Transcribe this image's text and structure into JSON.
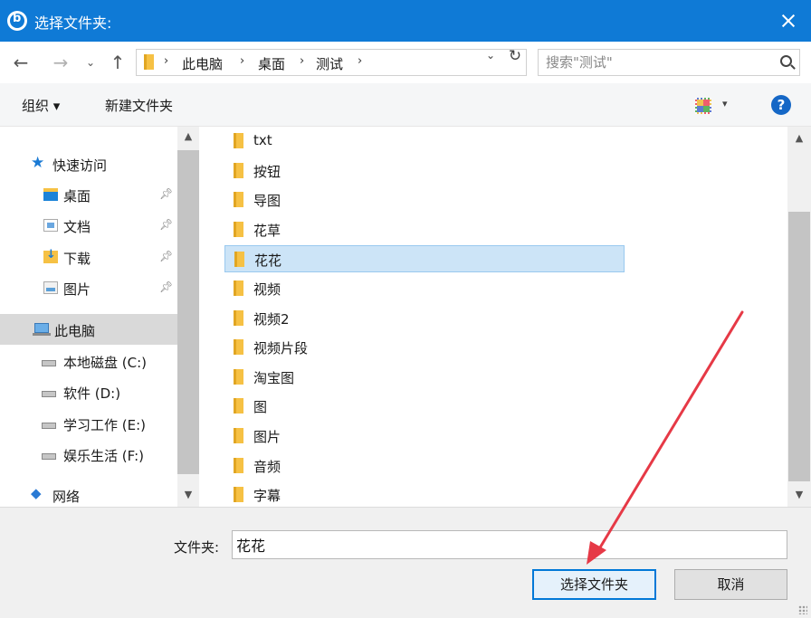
{
  "titlebar": {
    "title": "选择文件夹:"
  },
  "nav": {
    "back": "←",
    "forward": "→",
    "recent": "⌄",
    "up": "↑",
    "breadcrumbs": [
      "此电脑",
      "桌面",
      "测试"
    ],
    "separator": "›",
    "dropdown": "⌄",
    "refresh": "↻",
    "search_placeholder": "搜索\"测试\""
  },
  "toolbar": {
    "organize": "组织 ▾",
    "new_folder": "新建文件夹",
    "view_dropdown": "▾",
    "help": "?"
  },
  "sidebar": {
    "items": [
      {
        "label": "快速访问",
        "icon": "star-icon",
        "indent": 1,
        "pinned": false,
        "selected": false
      },
      {
        "label": "桌面",
        "icon": "desktop-icon",
        "indent": 2,
        "pinned": true,
        "selected": false
      },
      {
        "label": "文档",
        "icon": "document-icon",
        "indent": 2,
        "pinned": true,
        "selected": false
      },
      {
        "label": "下载",
        "icon": "download-icon",
        "indent": 2,
        "pinned": true,
        "selected": false
      },
      {
        "label": "图片",
        "icon": "picture-icon",
        "indent": 2,
        "pinned": true,
        "selected": false
      },
      {
        "label": "此电脑",
        "icon": "computer-icon",
        "indent": 1,
        "pinned": false,
        "selected": true
      },
      {
        "label": "本地磁盘 (C:)",
        "icon": "drive-icon",
        "indent": 2,
        "pinned": false,
        "selected": false
      },
      {
        "label": "软件 (D:)",
        "icon": "drive-icon",
        "indent": 2,
        "pinned": false,
        "selected": false
      },
      {
        "label": "学习工作 (E:)",
        "icon": "drive-icon",
        "indent": 2,
        "pinned": false,
        "selected": false
      },
      {
        "label": "娱乐生活 (F:)",
        "icon": "drive-icon",
        "indent": 2,
        "pinned": false,
        "selected": false
      },
      {
        "label": "网络",
        "icon": "network-icon",
        "indent": 1,
        "pinned": false,
        "selected": false
      }
    ]
  },
  "files": {
    "items": [
      {
        "name": "txt",
        "selected": false
      },
      {
        "name": "按钮",
        "selected": false
      },
      {
        "name": "导图",
        "selected": false
      },
      {
        "name": "花草",
        "selected": false
      },
      {
        "name": "花花",
        "selected": true
      },
      {
        "name": "视频",
        "selected": false
      },
      {
        "name": "视频2",
        "selected": false
      },
      {
        "name": "视频片段",
        "selected": false
      },
      {
        "name": "淘宝图",
        "selected": false
      },
      {
        "name": "图",
        "selected": false
      },
      {
        "name": "图片",
        "selected": false
      },
      {
        "name": "音频",
        "selected": false
      },
      {
        "name": "字幕",
        "selected": false
      }
    ]
  },
  "bottom": {
    "folder_label": "文件夹:",
    "folder_value": "花花",
    "select_button": "选择文件夹",
    "cancel_button": "取消"
  },
  "colors": {
    "titlebar": "#0f7ad6",
    "selection": "#cce4f7",
    "annotation_arrow": "#e63946"
  }
}
